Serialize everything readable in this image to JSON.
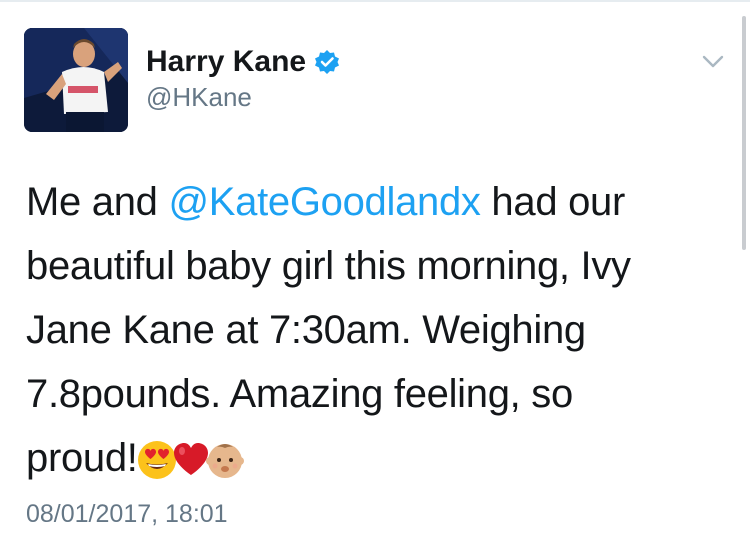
{
  "author": {
    "display_name": "Harry Kane",
    "handle": "@HKane",
    "verified": true
  },
  "tweet": {
    "lines": [
      {
        "before": "Me and ",
        "mention": "@KateGoodlandx",
        "after": " had our"
      },
      {
        "text": "beautiful baby girl this morning, Ivy"
      },
      {
        "text": "Jane Kane at 7:30am. Weighing"
      },
      {
        "text": "7.8pounds. Amazing feeling, so"
      },
      {
        "text": "proud!"
      }
    ],
    "emojis": [
      "heart-eyes-emoji",
      "red-heart-emoji",
      "baby-emoji"
    ],
    "timestamp": "08/01/2017, 18:01"
  },
  "colors": {
    "link": "#1da1f2",
    "text": "#14171a",
    "secondary": "#657786",
    "verified_badge": "#1da1f2"
  },
  "icons": {
    "verified": "verified-badge-icon",
    "menu": "chevron-down-icon"
  }
}
